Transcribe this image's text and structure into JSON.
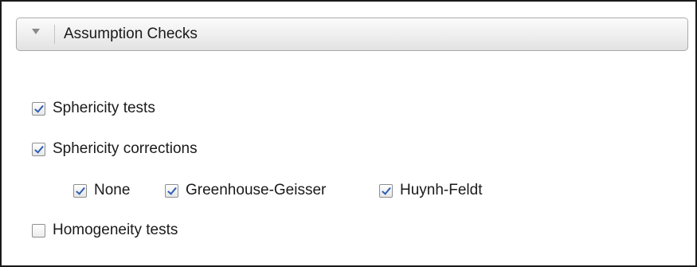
{
  "section": {
    "title": "Assumption Checks",
    "icon": "triangle-down-icon",
    "expanded": true
  },
  "options": {
    "sphericity_tests": {
      "label": "Sphericity tests",
      "checked": true
    },
    "sphericity_corrections": {
      "label": "Sphericity corrections",
      "checked": true
    },
    "corrections": {
      "none": {
        "label": "None",
        "checked": true
      },
      "greenhouse_geisser": {
        "label": "Greenhouse-Geisser",
        "checked": true
      },
      "huynh_feldt": {
        "label": "Huynh-Feldt",
        "checked": true
      }
    },
    "homogeneity_tests": {
      "label": "Homogeneity tests",
      "checked": false
    }
  },
  "colors": {
    "check_mark": "#2f5fb3",
    "checkbox_border": "#8e8f8f",
    "frame_border": "#1a1a1a"
  }
}
